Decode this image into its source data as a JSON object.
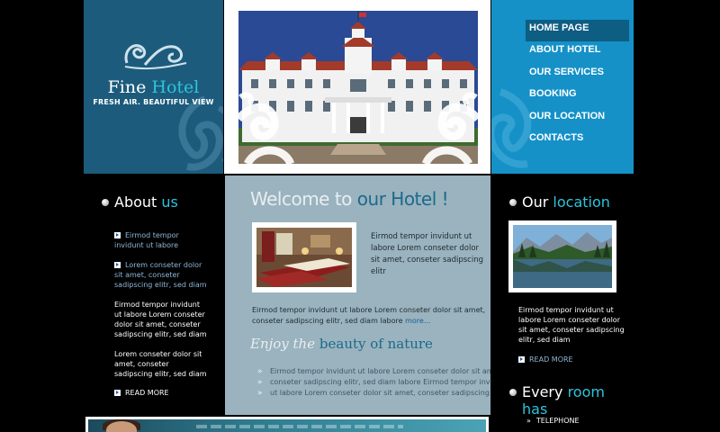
{
  "header": {
    "logo_word1": "Fine",
    "logo_word2": "Hotel",
    "tagline": "FRESH AIR. BEAUTIFUL VIEW"
  },
  "nav": {
    "items": [
      {
        "label": "HOME PAGE",
        "active": true
      },
      {
        "label": "ABOUT HOTEL",
        "active": false
      },
      {
        "label": "OUR SERVICES",
        "active": false
      },
      {
        "label": "BOOKING",
        "active": false
      },
      {
        "label": "OUR LOCATION",
        "active": false
      },
      {
        "label": "CONTACTS",
        "active": false
      }
    ]
  },
  "about": {
    "heading_part1": "About",
    "heading_part2": "us",
    "link1": "Eirmod tempor invidunt ut labore",
    "link2": "Lorem conseter dolor sit amet, conseter sadipscing elitr, sed diam",
    "para1": "Eirmod tempor invidunt ut labore Lorem conseter dolor sit amet, conseter sadipscing elitr, sed diam",
    "para2": "Lorem conseter dolor sit amet, conseter sadipscing elitr, sed diam",
    "read_more": "READ MORE"
  },
  "welcome": {
    "heading_part1": "Welcome to",
    "heading_part2": "our Hotel !",
    "intro": "Eirmod tempor invidunt ut labore Lorem conseter dolor sit amet, conseter sadipscing elitr",
    "paragraph": "Eirmod tempor invidunt ut labore Lorem conseter dolor sit amet, conseter sadipscing elitr, sed diam labore",
    "more_link": "more...",
    "enjoy_part1": "Enjoy the",
    "enjoy_part2": "beauty of nature",
    "bullets": [
      "Eirmod tempor invidunt ut labore Lorem conseter dolor sit amet,",
      "conseter sadipscing elitr, sed diam labore Eirmod tempor invidunt",
      "ut labore Lorem conseter dolor sit amet, conseter sadipscing"
    ]
  },
  "location": {
    "heading_part1": "Our",
    "heading_part2": "location",
    "text": "Eirmod tempor invidunt ut labore Lorem conseter dolor sit amet, conseter sadipscing elitr, sed diam",
    "read_more": "READ MORE"
  },
  "room": {
    "heading_part1": "Every",
    "heading_part2": "room has",
    "features": [
      "TELEPHONE"
    ]
  },
  "colors": {
    "header_dark_blue": "#1c5b7c",
    "nav_blue": "#1591c8",
    "accent_cyan": "#2ec4dd",
    "center_panel": "#9ab3be"
  }
}
